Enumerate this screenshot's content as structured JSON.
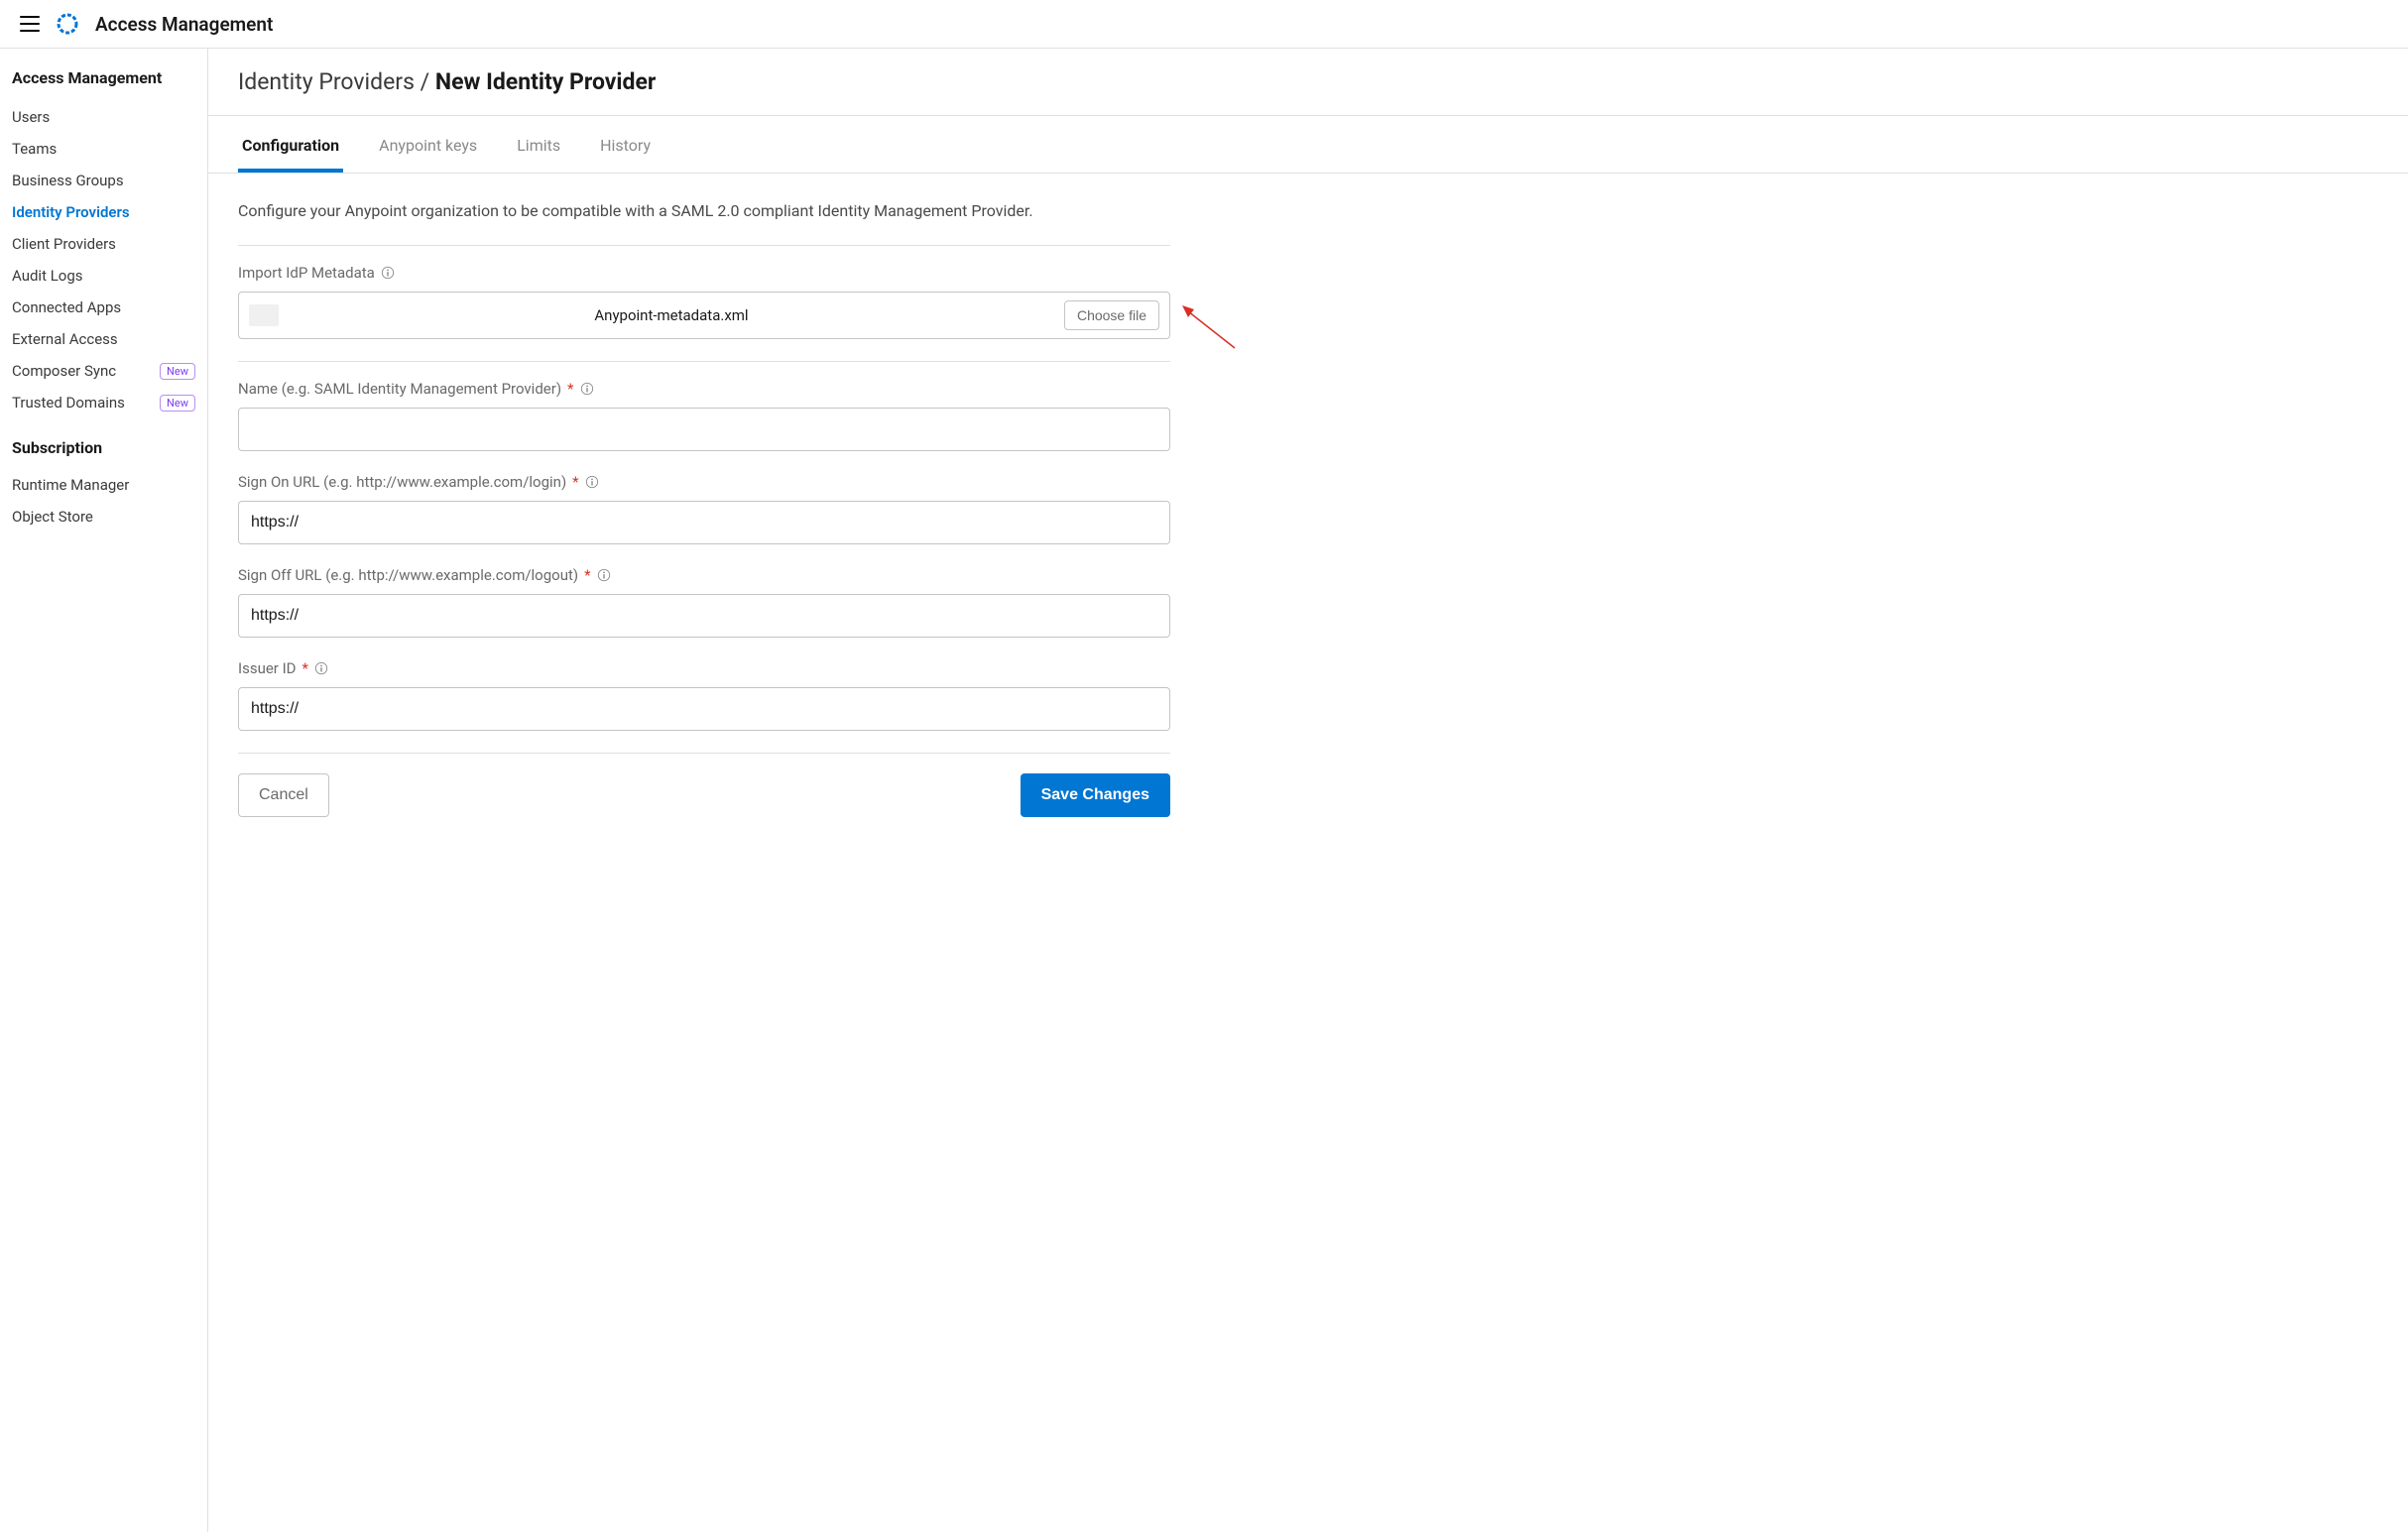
{
  "topbar": {
    "title": "Access Management"
  },
  "sidebar": {
    "heading": "Access Management",
    "items": [
      {
        "label": "Users",
        "active": false
      },
      {
        "label": "Teams",
        "active": false
      },
      {
        "label": "Business Groups",
        "active": false
      },
      {
        "label": "Identity Providers",
        "active": true
      },
      {
        "label": "Client Providers",
        "active": false
      },
      {
        "label": "Audit Logs",
        "active": false
      },
      {
        "label": "Connected Apps",
        "active": false
      },
      {
        "label": "External Access",
        "active": false
      },
      {
        "label": "Composer Sync",
        "active": false,
        "badge": "New"
      },
      {
        "label": "Trusted Domains",
        "active": false,
        "badge": "New"
      }
    ],
    "section2_heading": "Subscription",
    "section2_items": [
      {
        "label": "Runtime Manager"
      },
      {
        "label": "Object Store"
      }
    ]
  },
  "breadcrumb": {
    "parent": "Identity Providers",
    "separator": " / ",
    "current": "New Identity Provider"
  },
  "tabs": [
    {
      "label": "Configuration",
      "active": true
    },
    {
      "label": "Anypoint keys",
      "active": false
    },
    {
      "label": "Limits",
      "active": false
    },
    {
      "label": "History",
      "active": false
    }
  ],
  "form": {
    "intro": "Configure your Anypoint organization to be compatible with a SAML 2.0 compliant Identity Management Provider.",
    "import_label": "Import IdP Metadata",
    "import_filename": "Anypoint-metadata.xml",
    "choose_file_label": "Choose file",
    "name_label": "Name (e.g. SAML Identity Management Provider)",
    "name_value": "",
    "signon_label": "Sign On URL (e.g. http://www.example.com/login)",
    "signon_value": "https://",
    "signoff_label": "Sign Off URL (e.g. http://www.example.com/logout)",
    "signoff_value": "https://",
    "issuer_label": "Issuer ID",
    "issuer_value": "https://",
    "cancel_label": "Cancel",
    "save_label": "Save Changes"
  }
}
